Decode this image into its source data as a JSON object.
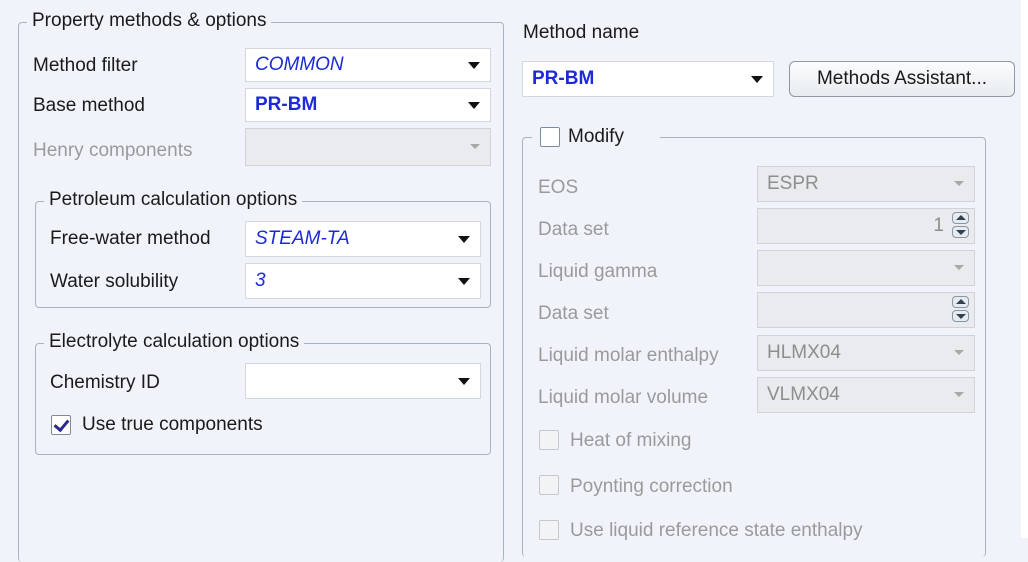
{
  "left_panel": {
    "legend": "Property methods & options",
    "method_filter": {
      "label": "Method filter",
      "value": "COMMON"
    },
    "base_method": {
      "label": "Base method",
      "value": "PR-BM"
    },
    "henry_components": {
      "label": "Henry components",
      "value": ""
    },
    "petroleum": {
      "legend": "Petroleum calculation options",
      "free_water": {
        "label": "Free-water method",
        "value": "STEAM-TA"
      },
      "water_solubility": {
        "label": "Water solubility",
        "value": "3"
      }
    },
    "electrolyte": {
      "legend": "Electrolyte calculation options",
      "chemistry_id": {
        "label": "Chemistry ID",
        "value": ""
      },
      "use_true_components": {
        "label": "Use true components",
        "checked": true
      }
    }
  },
  "right_panel": {
    "method_name_label": "Method name",
    "method_name_value": "PR-BM",
    "methods_assistant_button": "Methods Assistant...",
    "modify": {
      "label": "Modify",
      "checked": false,
      "eos": {
        "label": "EOS",
        "value": "ESPR"
      },
      "data_set_1": {
        "label": "Data set",
        "value": "1"
      },
      "liquid_gamma": {
        "label": "Liquid gamma",
        "value": ""
      },
      "data_set_2": {
        "label": "Data set",
        "value": ""
      },
      "liquid_molar_enthalpy": {
        "label": "Liquid molar enthalpy",
        "value": "HLMX04"
      },
      "liquid_molar_volume": {
        "label": "Liquid molar volume",
        "value": "VLMX04"
      },
      "heat_of_mixing": {
        "label": "Heat of mixing",
        "checked": false
      },
      "poynting_correction": {
        "label": "Poynting correction",
        "checked": false
      },
      "use_liquid_reference": {
        "label": "Use liquid reference state enthalpy",
        "checked": false
      }
    }
  },
  "colors": {
    "background": "#f0f4fa",
    "value_blue": "#1c2ad8",
    "disabled_text": "#9a9a9a"
  }
}
